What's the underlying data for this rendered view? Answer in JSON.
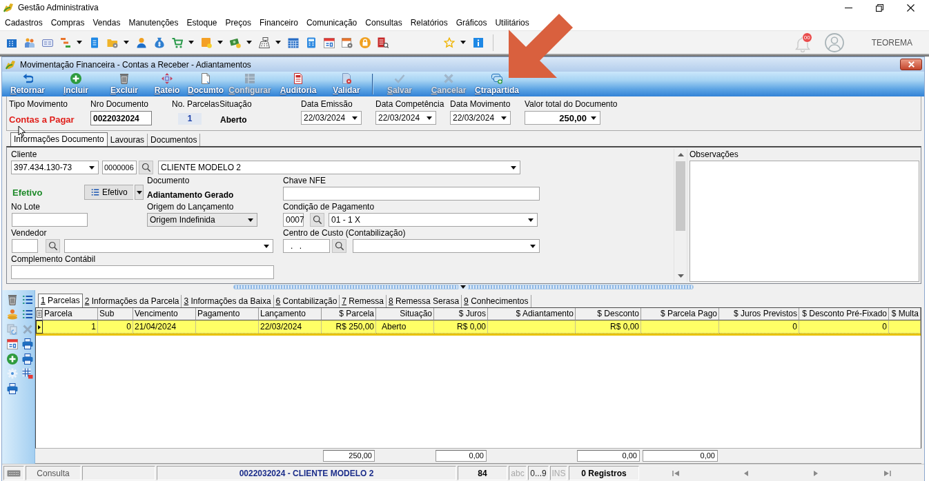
{
  "window": {
    "title": "Gestão Administrativa"
  },
  "menu": [
    "Cadastros",
    "Compras",
    "Vendas",
    "Manutenções",
    "Estoque",
    "Preços",
    "Financeiro",
    "Comunicação",
    "Consultas",
    "Relatórios",
    "Gráficos",
    "Utilitários"
  ],
  "toolbar": {
    "notifications": "00",
    "user": "TEOREMA"
  },
  "document_window": {
    "title": "Movimentação Financeira - Contas a Receber - Adiantamentos"
  },
  "actions": [
    [
      {
        "label": "Retornar",
        "disabled": false
      },
      {
        "label": "Incluir",
        "disabled": false
      },
      {
        "label": "Excluir",
        "disabled": false
      },
      {
        "label": "Rateio",
        "disabled": false
      },
      {
        "label": "Documto",
        "disabled": false
      },
      {
        "label": "Configurar",
        "disabled": true
      },
      {
        "label": "Auditoria",
        "disabled": false
      },
      {
        "label": "Validar",
        "disabled": false
      }
    ],
    [
      {
        "label": "Salvar",
        "disabled": true
      },
      {
        "label": "Cancelar",
        "disabled": true
      },
      {
        "label": "Ctrapartida",
        "disabled": false
      }
    ]
  ],
  "header": [
    {
      "kind": "type",
      "label": "Tipo Movimento",
      "value": "Contas a Pagar"
    },
    {
      "kind": "input",
      "label": "Nro Documento",
      "value": "0022032024"
    },
    {
      "kind": "count",
      "label": "No. Parcelas",
      "value": "1"
    },
    {
      "kind": "status",
      "label": "Situação",
      "value": "Aberto"
    },
    {
      "kind": "date",
      "label": "Data Emissão",
      "value": "22/03/2024"
    },
    {
      "kind": "date",
      "label": "Data Competência",
      "value": "22/03/2024"
    },
    {
      "kind": "date",
      "label": "Data Movimento",
      "value": "22/03/2024"
    },
    {
      "kind": "total",
      "label": "Valor total do Documento",
      "value": "250,00"
    }
  ],
  "tabs": [
    {
      "label": "Informações Documento",
      "selected": true
    },
    {
      "label": "Lavouras",
      "selected": false
    },
    {
      "label": "Documentos",
      "selected": false
    }
  ],
  "form": {
    "cliente": {
      "label": "Cliente",
      "document": "397.434.130-73",
      "code": "0000006",
      "name": "CLIENTE MODELO 2"
    },
    "situacao": {
      "value": "Efetivo",
      "button": "Efetivo"
    },
    "documento": {
      "label": "Documento",
      "value": "Adiantamento Gerado"
    },
    "chave_nfe": {
      "label": "Chave NFE"
    },
    "no_lote": {
      "label": "No Lote"
    },
    "origem": {
      "label": "Origem do Lançamento",
      "value": "Origem Indefinida"
    },
    "condicao_pagamento": {
      "label": "Condição de Pagamento",
      "code": "0007",
      "value": "01 - 1 X"
    },
    "vendedor": {
      "label": "Vendedor"
    },
    "centro_custo": {
      "label": "Centro de Custo (Contabilização)",
      "code": ". ."
    },
    "complemento": {
      "label": "Complemento Contábil"
    }
  },
  "observacoes": {
    "label": "Observações"
  },
  "detail_tabs": [
    {
      "label": "1 Parcelas",
      "selected": true
    },
    {
      "label": "2 Informações da Parcela",
      "selected": false
    },
    {
      "label": "3 Informações da Baixa",
      "selected": false
    },
    {
      "label": "6 Contabilização",
      "selected": false
    },
    {
      "label": "7 Remessa",
      "selected": false
    },
    {
      "label": "8 Remessa Serasa",
      "selected": false
    },
    {
      "label": "9 Conhecimentos",
      "selected": false
    }
  ],
  "side_tools": [
    {
      "disabled": false
    },
    {
      "disabled": false
    },
    {
      "disabled": false
    },
    {
      "disabled": false
    },
    {
      "disabled": true
    },
    {
      "disabled": true
    },
    {
      "disabled": false
    },
    {
      "disabled": false
    },
    {
      "disabled": false
    },
    {
      "disabled": false
    },
    {
      "disabled": false
    },
    {
      "disabled": false
    },
    {
      "disabled": false
    }
  ],
  "grid": {
    "columns": [
      {
        "label": "Parcela",
        "kind": "number"
      },
      {
        "label": "Sub",
        "kind": "number"
      },
      {
        "label": "Vencimento",
        "kind": "date"
      },
      {
        "label": "Pagamento",
        "kind": "date"
      },
      {
        "label": "Lançamento",
        "kind": "date"
      },
      {
        "label": "$ Parcela",
        "kind": "money",
        "total": "250,00"
      },
      {
        "label": "Situação",
        "kind": "status"
      },
      {
        "label": "$ Juros",
        "kind": "money",
        "total": "0,00"
      },
      {
        "label": "$ Adiantamento",
        "kind": "money"
      },
      {
        "label": "$ Desconto",
        "kind": "money",
        "total": "0,00"
      },
      {
        "label": "$ Parcela Pago",
        "kind": "money",
        "total": "0,00"
      },
      {
        "label": "$ Juros Previstos",
        "kind": "money"
      },
      {
        "label": "$ Desconto Pré-Fixado",
        "kind": "money"
      },
      {
        "label": "$ Multa",
        "kind": "money"
      }
    ],
    "rows": [
      {
        "selected": true,
        "cells": [
          "1",
          "0",
          "21/04/2024",
          null,
          "22/03/2024",
          "R$ 250,00",
          "Aberto",
          "R$ 0,00",
          null,
          "R$ 0,00",
          null,
          "0",
          "0",
          null
        ]
      }
    ]
  },
  "status_bar": {
    "mode": "Consulta",
    "record": "0022032024 - CLIENTE MODELO 2",
    "count": "84",
    "indicators": [
      {
        "label": "abc",
        "on": false
      },
      {
        "label": "0...9",
        "on": true
      },
      {
        "label": "INS",
        "on": false
      }
    ],
    "records": "0 Registros"
  }
}
